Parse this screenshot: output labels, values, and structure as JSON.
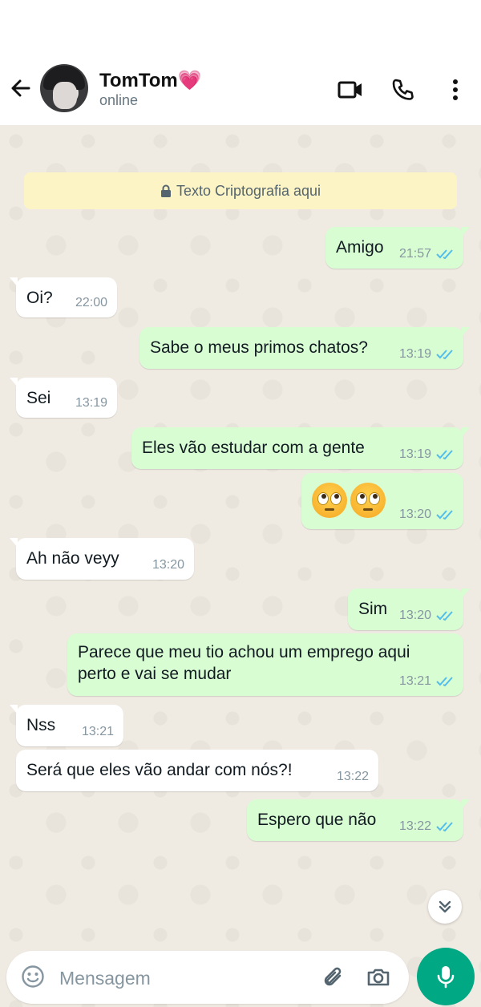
{
  "header": {
    "contact_name": "TomTom💗",
    "status": "online"
  },
  "encryption_notice": "Texto Criptografia aqui",
  "messages": [
    {
      "dir": "out",
      "text": "Amigo",
      "time": "21:57",
      "read": true
    },
    {
      "dir": "in",
      "text": "Oi?",
      "time": "22:00"
    },
    {
      "dir": "out",
      "text": "Sabe o meus primos chatos?",
      "time": "13:19",
      "read": true
    },
    {
      "dir": "in",
      "text": "Sei",
      "time": "13:19"
    },
    {
      "dir": "out",
      "text": "Eles vão estudar com a gente",
      "time": "13:19",
      "read": true
    },
    {
      "dir": "out",
      "emoji": "face-with-rolling-eyes x2",
      "time": "13:20",
      "read": true
    },
    {
      "dir": "in",
      "text": "Ah não veyy",
      "time": "13:20"
    },
    {
      "dir": "out",
      "text": "Sim",
      "time": "13:20",
      "read": true
    },
    {
      "dir": "out",
      "text_line1": "Parece que meu tio achou um emprego aqui",
      "text_line2": "perto e vai se mudar",
      "time": "13:21",
      "read": true
    },
    {
      "dir": "in",
      "text": "Nss",
      "time": "13:21"
    },
    {
      "dir": "in",
      "text": "Será que eles vão andar com nós?!",
      "time": "13:22"
    },
    {
      "dir": "out",
      "text": "Espero que não",
      "time": "13:22",
      "read": true
    }
  ],
  "composer": {
    "placeholder": "Mensagem"
  },
  "colors": {
    "outgoing_bubble": "#d9fdd3",
    "incoming_bubble": "#ffffff",
    "chat_background": "#efeae2",
    "read_ticks": "#53bdeb",
    "accent": "#00a884",
    "encryption_banner": "#fdf4c5"
  },
  "icons": {
    "back": "arrow-left-icon",
    "video": "video-camera-icon",
    "call": "phone-icon",
    "menu": "more-vertical-icon",
    "lock": "lock-icon",
    "scroll": "double-chevron-down-icon",
    "emoji": "smiley-icon",
    "attach": "paperclip-icon",
    "camera": "camera-icon",
    "mic": "microphone-icon"
  }
}
